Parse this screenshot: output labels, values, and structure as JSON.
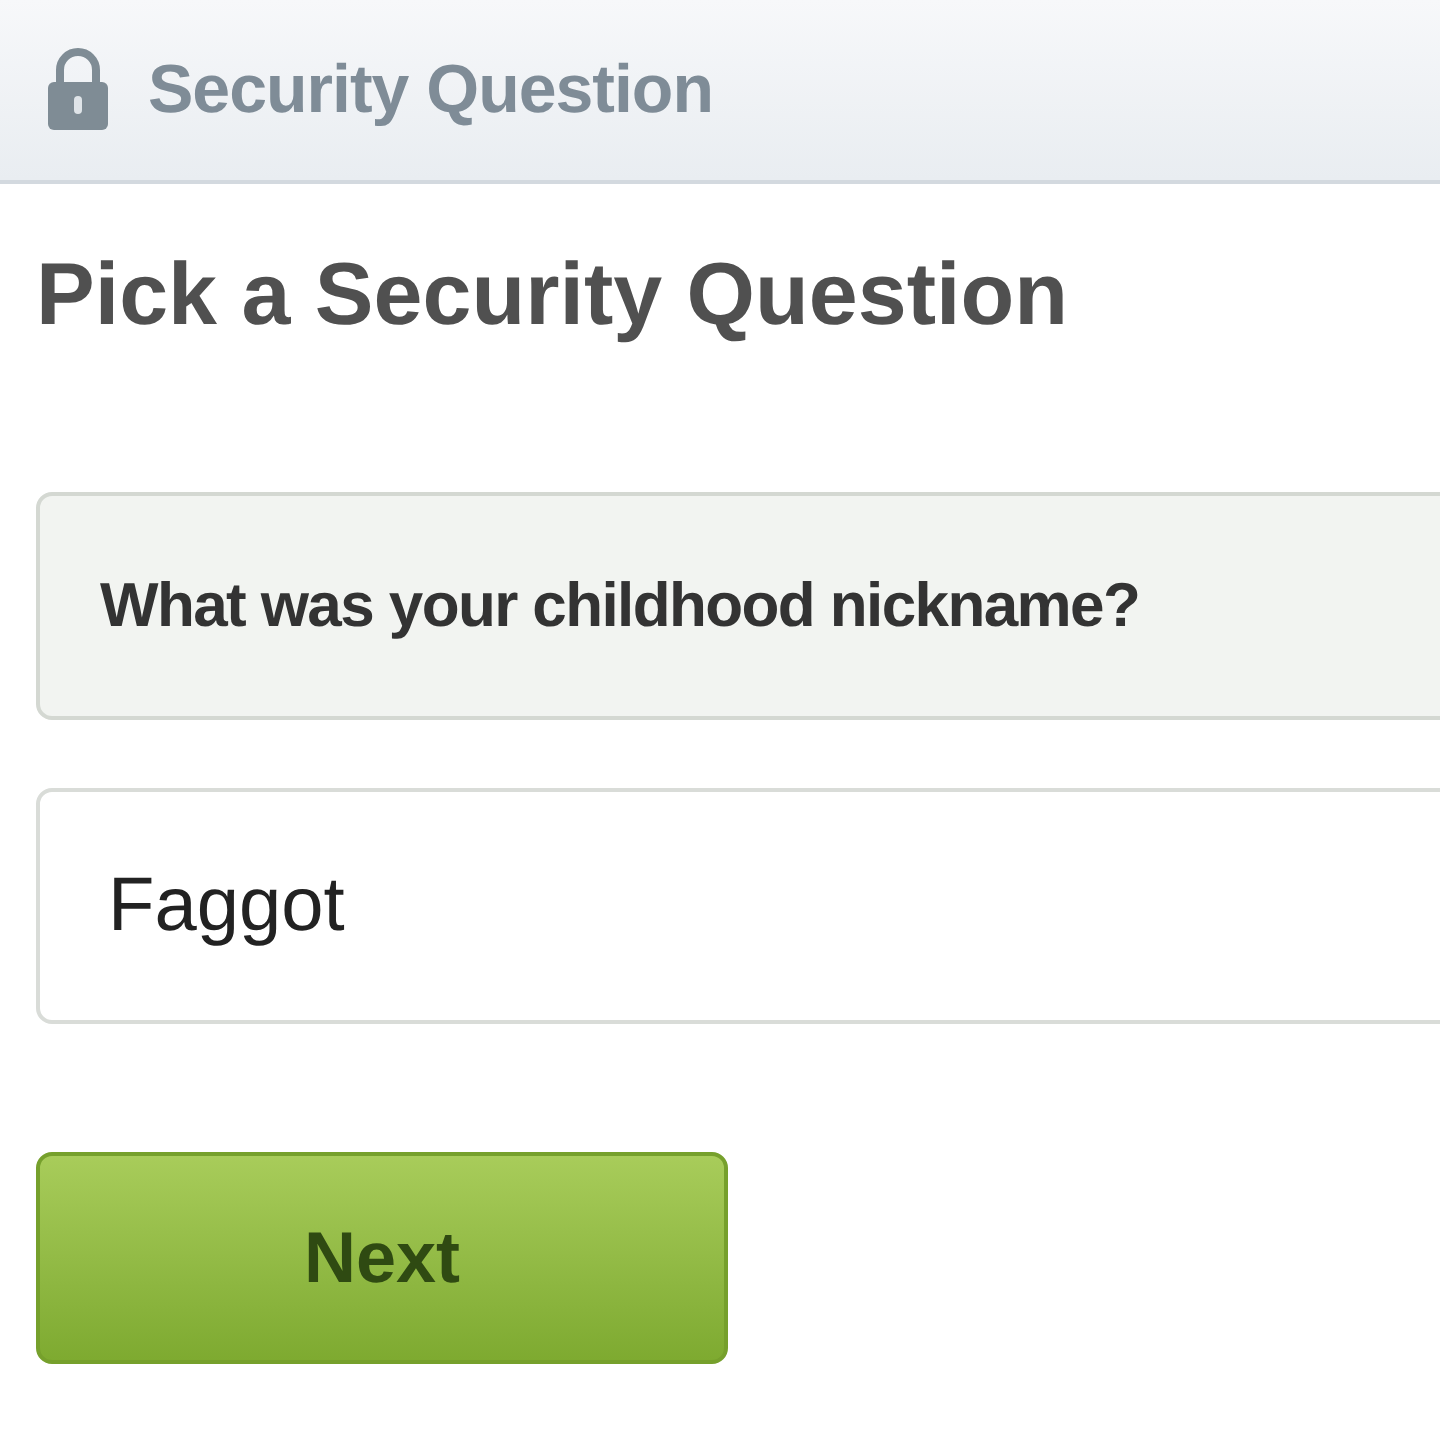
{
  "header": {
    "title": "Security Question"
  },
  "heading": "Pick a Security Question",
  "question": {
    "value": "What was your childhood nickname?"
  },
  "answer": {
    "value": "Faggot"
  },
  "buttons": [
    "Next"
  ]
}
